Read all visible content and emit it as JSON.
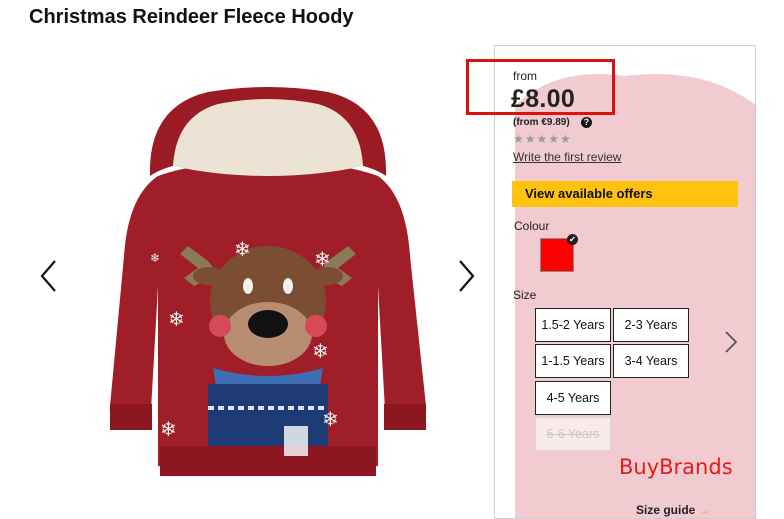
{
  "product": {
    "title": "Christmas Reindeer Fleece Hoody"
  },
  "price": {
    "from_label": "from",
    "amount": "£8.00",
    "alt_currency": "(from €9.89)",
    "help_icon": "?"
  },
  "rating": {
    "stars": "★★★★★",
    "stars_filled": 0,
    "stars_total": 5,
    "review_link": "Write the first review"
  },
  "offers": {
    "button_label": "View available offers",
    "color": "#ffc20e"
  },
  "colour": {
    "label": "Colour",
    "selected_swatch": "#ff0000"
  },
  "size": {
    "label": "Size",
    "options": [
      {
        "label": "1.5-2 Years",
        "available": true
      },
      {
        "label": "2-3 Years",
        "available": true
      },
      {
        "label": "1-1.5 Years",
        "available": true
      },
      {
        "label": "3-4 Years",
        "available": true
      },
      {
        "label": "4-5 Years",
        "available": true
      },
      {
        "label": "5-6 Years",
        "available": false
      }
    ],
    "guide_label": "Size guide",
    "guide_arrow": "→"
  },
  "watermark": "BuyBrands",
  "icons": {
    "prev": "chevron-left-icon",
    "next": "chevron-right-icon",
    "size_next": "chevron-right-icon"
  }
}
